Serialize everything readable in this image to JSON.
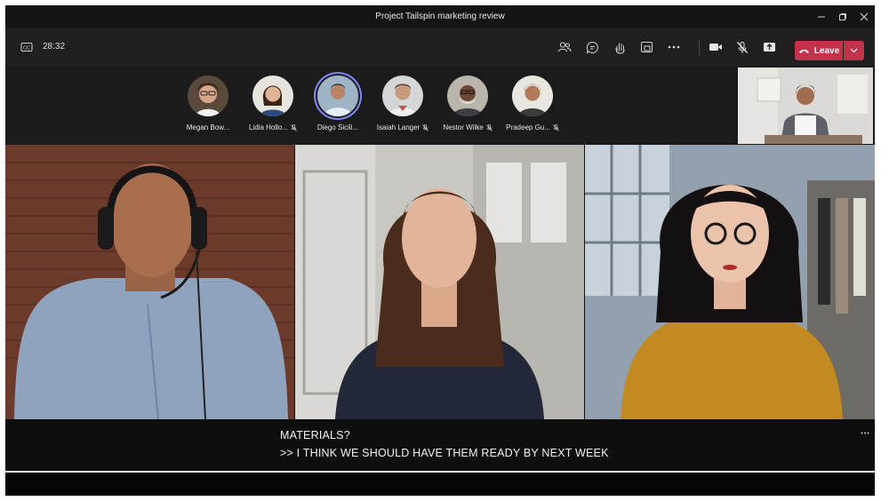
{
  "window": {
    "title": "Project Tailspin marketing review"
  },
  "toolbar": {
    "timer": "28:32",
    "leave_label": "Leave",
    "icons": [
      "closed-captions-icon",
      "people-icon",
      "chat-icon",
      "raise-hand-icon",
      "share-tray-icon",
      "more-icon",
      "camera-icon",
      "mic-muted-icon",
      "share-icon",
      "phone-hangup-icon",
      "chevron-down-icon"
    ],
    "leave_color": "#c4314b"
  },
  "participants": [
    {
      "name": "Megan Bow...",
      "muted": false,
      "active": false
    },
    {
      "name": "Lidia Hollo...",
      "muted": true,
      "active": false
    },
    {
      "name": "Diego Sicili...",
      "muted": false,
      "active": true
    },
    {
      "name": "Isaiah Langer",
      "muted": true,
      "active": false
    },
    {
      "name": "Nestor Wilke",
      "muted": true,
      "active": false
    },
    {
      "name": "Pradeep Gu...",
      "muted": true,
      "active": false
    }
  ],
  "captions": {
    "line1": "MATERIALS?",
    "line2": ">> I THINK WE SHOULD HAVE THEM READY BY NEXT WEEK"
  },
  "colors": {
    "accent": "#7f85f5",
    "background": "#1f1f1f"
  }
}
